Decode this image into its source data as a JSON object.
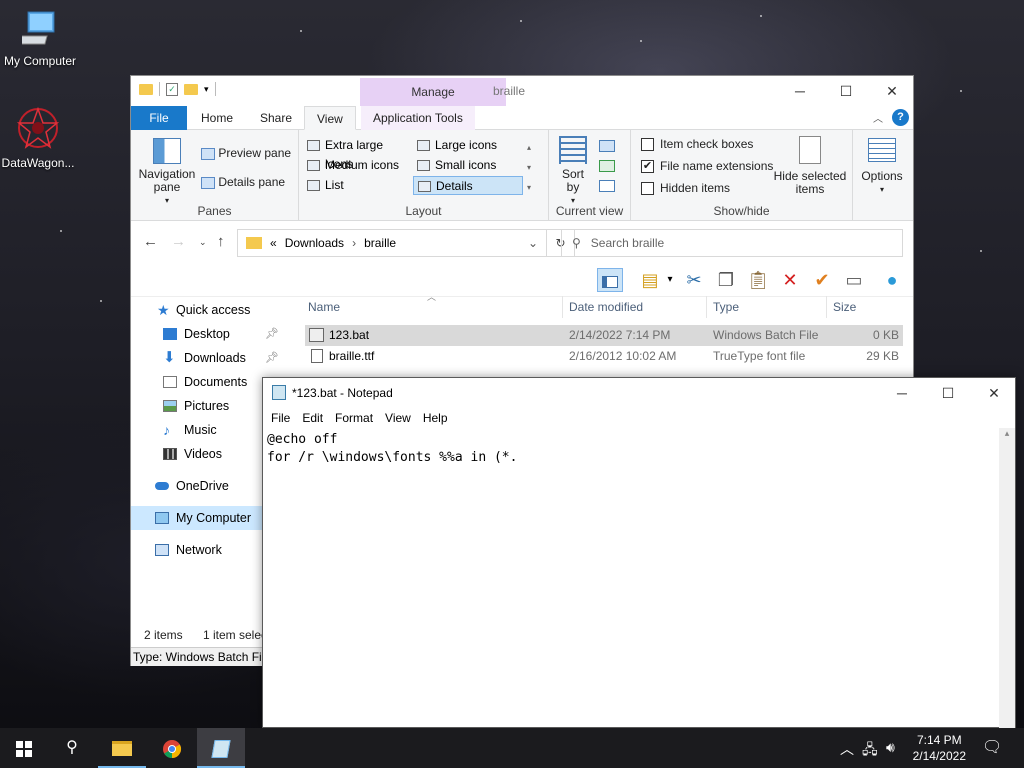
{
  "desktop": {
    "icons": [
      {
        "label": "My Computer"
      },
      {
        "label": "DataWagon..."
      }
    ]
  },
  "explorer": {
    "title": "braille",
    "manage_tab": "Manage",
    "tabs": [
      "File",
      "Home",
      "Share",
      "View",
      "Application Tools"
    ],
    "ribbon": {
      "panes": {
        "navigation_pane": "Navigation pane",
        "preview_pane": "Preview pane",
        "details_pane": "Details pane",
        "label": "Panes"
      },
      "layout": {
        "items": [
          "Extra large icons",
          "Large icons",
          "Medium icons",
          "Small icons",
          "List",
          "Details"
        ],
        "selected": "Details",
        "label": "Layout"
      },
      "current_view": {
        "sort_by": "Sort by",
        "label": "Current view"
      },
      "show_hide": {
        "item_check_boxes": "Item check boxes",
        "file_name_extensions": "File name extensions",
        "hidden_items": "Hidden items",
        "hide_selected_items": "Hide selected items",
        "label": "Show/hide",
        "item_check_boxes_checked": false,
        "file_name_extensions_checked": true,
        "hidden_items_checked": false
      },
      "options": "Options"
    },
    "address": {
      "prefix": "«",
      "crumbs": [
        "Downloads",
        "braille"
      ]
    },
    "search_placeholder": "Search braille",
    "nav": [
      {
        "label": "Quick access",
        "icon": "star-icon"
      },
      {
        "label": "Desktop",
        "icon": "desktop-icon",
        "pinned": true
      },
      {
        "label": "Downloads",
        "icon": "download-icon",
        "pinned": true
      },
      {
        "label": "Documents",
        "icon": "documents-icon"
      },
      {
        "label": "Pictures",
        "icon": "pictures-icon"
      },
      {
        "label": "Music",
        "icon": "music-icon"
      },
      {
        "label": "Videos",
        "icon": "videos-icon"
      },
      {
        "label": "OneDrive",
        "icon": "cloud-icon"
      },
      {
        "label": "My Computer",
        "icon": "computer-icon",
        "selected": true
      },
      {
        "label": "Network",
        "icon": "network-icon"
      }
    ],
    "columns": [
      "Name",
      "Date modified",
      "Type",
      "Size"
    ],
    "files": [
      {
        "name": "123.bat",
        "date": "2/14/2022 7:14 PM",
        "type": "Windows Batch File",
        "size": "0 KB",
        "selected": true
      },
      {
        "name": "braille.ttf",
        "date": "2/16/2012 10:02 AM",
        "type": "TrueType font file",
        "size": "29 KB"
      }
    ],
    "status": {
      "count": "2 items",
      "selection": "1 item selec"
    },
    "type_bar": "Type: Windows Batch File"
  },
  "notepad": {
    "title": "*123.bat - Notepad",
    "menu": [
      "File",
      "Edit",
      "Format",
      "View",
      "Help"
    ],
    "content": "@echo off\nfor /r \\windows\\fonts %%a in (*."
  },
  "taskbar": {
    "time": "7:14 PM",
    "date": "2/14/2022"
  }
}
